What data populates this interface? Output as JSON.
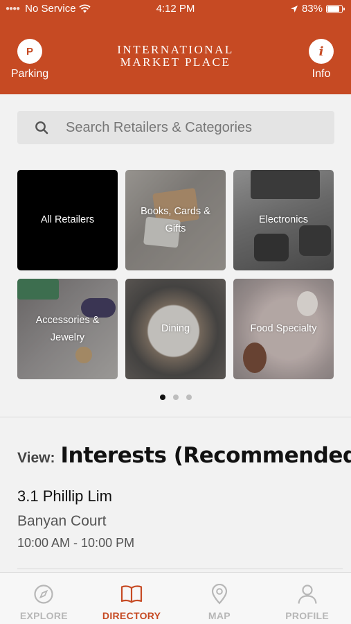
{
  "status_bar": {
    "carrier": "No Service",
    "time": "4:12 PM",
    "battery": "83%",
    "battery_level": 0.83
  },
  "header": {
    "logo_line1": "INTERNATIONAL",
    "logo_line2": "MARKET PLACE",
    "parking_badge": "P",
    "parking_label": "Parking",
    "info_badge": "i",
    "info_label": "Info",
    "background_color": "#c64a23"
  },
  "search": {
    "placeholder": "Search Retailers & Categories"
  },
  "categories": [
    {
      "label": "All Retailers"
    },
    {
      "label": "Books, Cards & Gifts"
    },
    {
      "label": "Electronics"
    },
    {
      "label": "Accessories & Jewelry"
    },
    {
      "label": "Dining"
    },
    {
      "label": "Food Specialty"
    }
  ],
  "pager": {
    "pages": 3,
    "current": 1
  },
  "view": {
    "label": "View:",
    "value": "Interests (Recommended)"
  },
  "listing": {
    "name": "3.1 Phillip Lim",
    "location": "Banyan Court",
    "hours": "10:00 AM - 10:00 PM"
  },
  "nav": {
    "items": [
      {
        "label": "EXPLORE",
        "icon": "compass-icon"
      },
      {
        "label": "DIRECTORY",
        "icon": "book-icon"
      },
      {
        "label": "MAP",
        "icon": "map-pin-icon"
      },
      {
        "label": "PROFILE",
        "icon": "person-icon"
      }
    ],
    "active": "DIRECTORY",
    "active_color": "#c64a23"
  }
}
